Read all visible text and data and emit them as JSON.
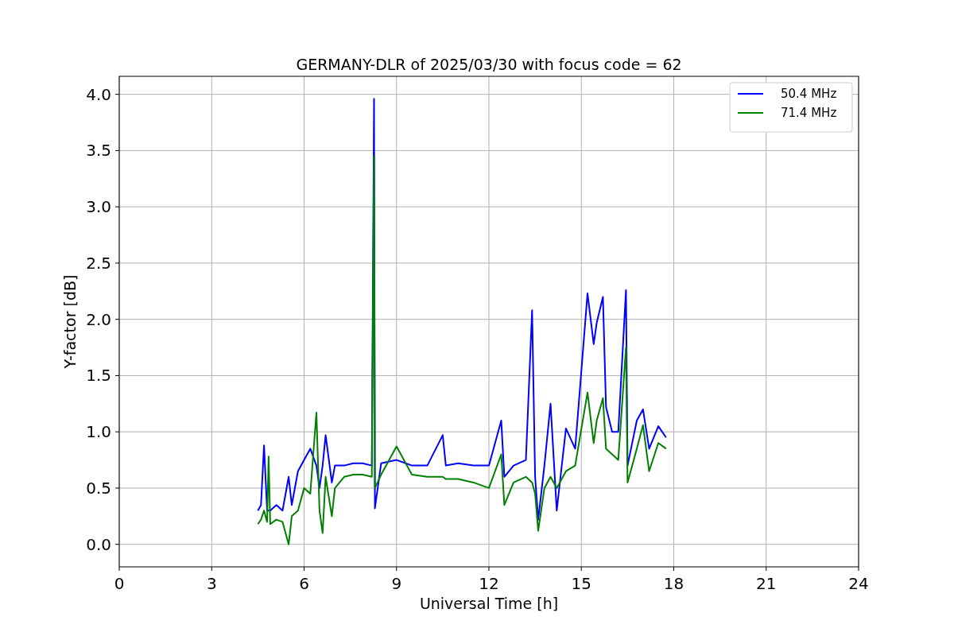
{
  "chart_data": {
    "type": "line",
    "title": "GERMANY-DLR of 2025/03/30 with focus code = 62",
    "xlabel": "Universal Time [h]",
    "ylabel": "Y-factor [dB]",
    "x": [
      4.5,
      4.6,
      4.7,
      4.8,
      4.85,
      4.9,
      5.1,
      5.3,
      5.5,
      5.6,
      5.8,
      6.0,
      6.2,
      6.4,
      6.5,
      6.6,
      6.7,
      6.9,
      7.0,
      7.3,
      7.6,
      7.9,
      8.2,
      8.27,
      8.3,
      8.5,
      9.0,
      9.5,
      10.0,
      10.5,
      10.6,
      11.0,
      11.5,
      12.0,
      12.4,
      12.5,
      12.8,
      13.2,
      13.4,
      13.5,
      13.6,
      13.8,
      14.0,
      14.2,
      14.5,
      14.8,
      15.2,
      15.4,
      15.5,
      15.7,
      15.8,
      16.0,
      16.2,
      16.45,
      16.5,
      16.8,
      17.0,
      17.2,
      17.5,
      17.75
    ],
    "series": [
      {
        "name": "50.4 MHz",
        "color": "#0000ff",
        "values": [
          0.3,
          0.35,
          0.88,
          0.3,
          0.3,
          0.3,
          0.35,
          0.3,
          0.6,
          0.35,
          0.65,
          0.75,
          0.85,
          0.7,
          0.5,
          0.7,
          0.97,
          0.55,
          0.7,
          0.7,
          0.72,
          0.72,
          0.7,
          3.96,
          0.32,
          0.72,
          0.75,
          0.7,
          0.7,
          0.97,
          0.7,
          0.72,
          0.7,
          0.7,
          1.1,
          0.6,
          0.7,
          0.75,
          2.08,
          0.6,
          0.22,
          0.7,
          1.25,
          0.3,
          1.03,
          0.85,
          2.23,
          1.78,
          1.97,
          2.2,
          1.22,
          1.0,
          1.0,
          2.26,
          0.7,
          1.1,
          1.2,
          0.85,
          1.05,
          0.95
        ]
      },
      {
        "name": "71.4 MHz",
        "color": "#008000",
        "values": [
          0.18,
          0.22,
          0.3,
          0.2,
          0.78,
          0.18,
          0.22,
          0.2,
          0.0,
          0.25,
          0.3,
          0.5,
          0.45,
          1.17,
          0.3,
          0.1,
          0.6,
          0.25,
          0.5,
          0.6,
          0.62,
          0.62,
          0.6,
          3.45,
          0.5,
          0.62,
          0.87,
          0.62,
          0.6,
          0.6,
          0.58,
          0.58,
          0.55,
          0.5,
          0.8,
          0.35,
          0.55,
          0.6,
          0.55,
          0.45,
          0.12,
          0.5,
          0.6,
          0.5,
          0.65,
          0.7,
          1.35,
          0.9,
          1.1,
          1.3,
          0.85,
          0.8,
          0.75,
          1.75,
          0.55,
          0.85,
          1.06,
          0.65,
          0.9,
          0.85
        ]
      }
    ],
    "grid": true,
    "legend": true,
    "xlim": [
      0,
      24
    ],
    "ylim": [
      -0.2,
      4.16
    ],
    "xticks": [
      0,
      3,
      6,
      9,
      12,
      15,
      18,
      21,
      24
    ],
    "yticks": [
      {
        "value": 0,
        "label": "0.0"
      },
      {
        "value": 0.5,
        "label": "0.5"
      },
      {
        "value": 1,
        "label": "1.0"
      },
      {
        "value": 1.5,
        "label": "1.5"
      },
      {
        "value": 2,
        "label": "2.0"
      },
      {
        "value": 2.5,
        "label": "2.5"
      },
      {
        "value": 3,
        "label": "3.0"
      },
      {
        "value": 3.5,
        "label": "3.5"
      },
      {
        "value": 4,
        "label": "4.0"
      }
    ]
  }
}
